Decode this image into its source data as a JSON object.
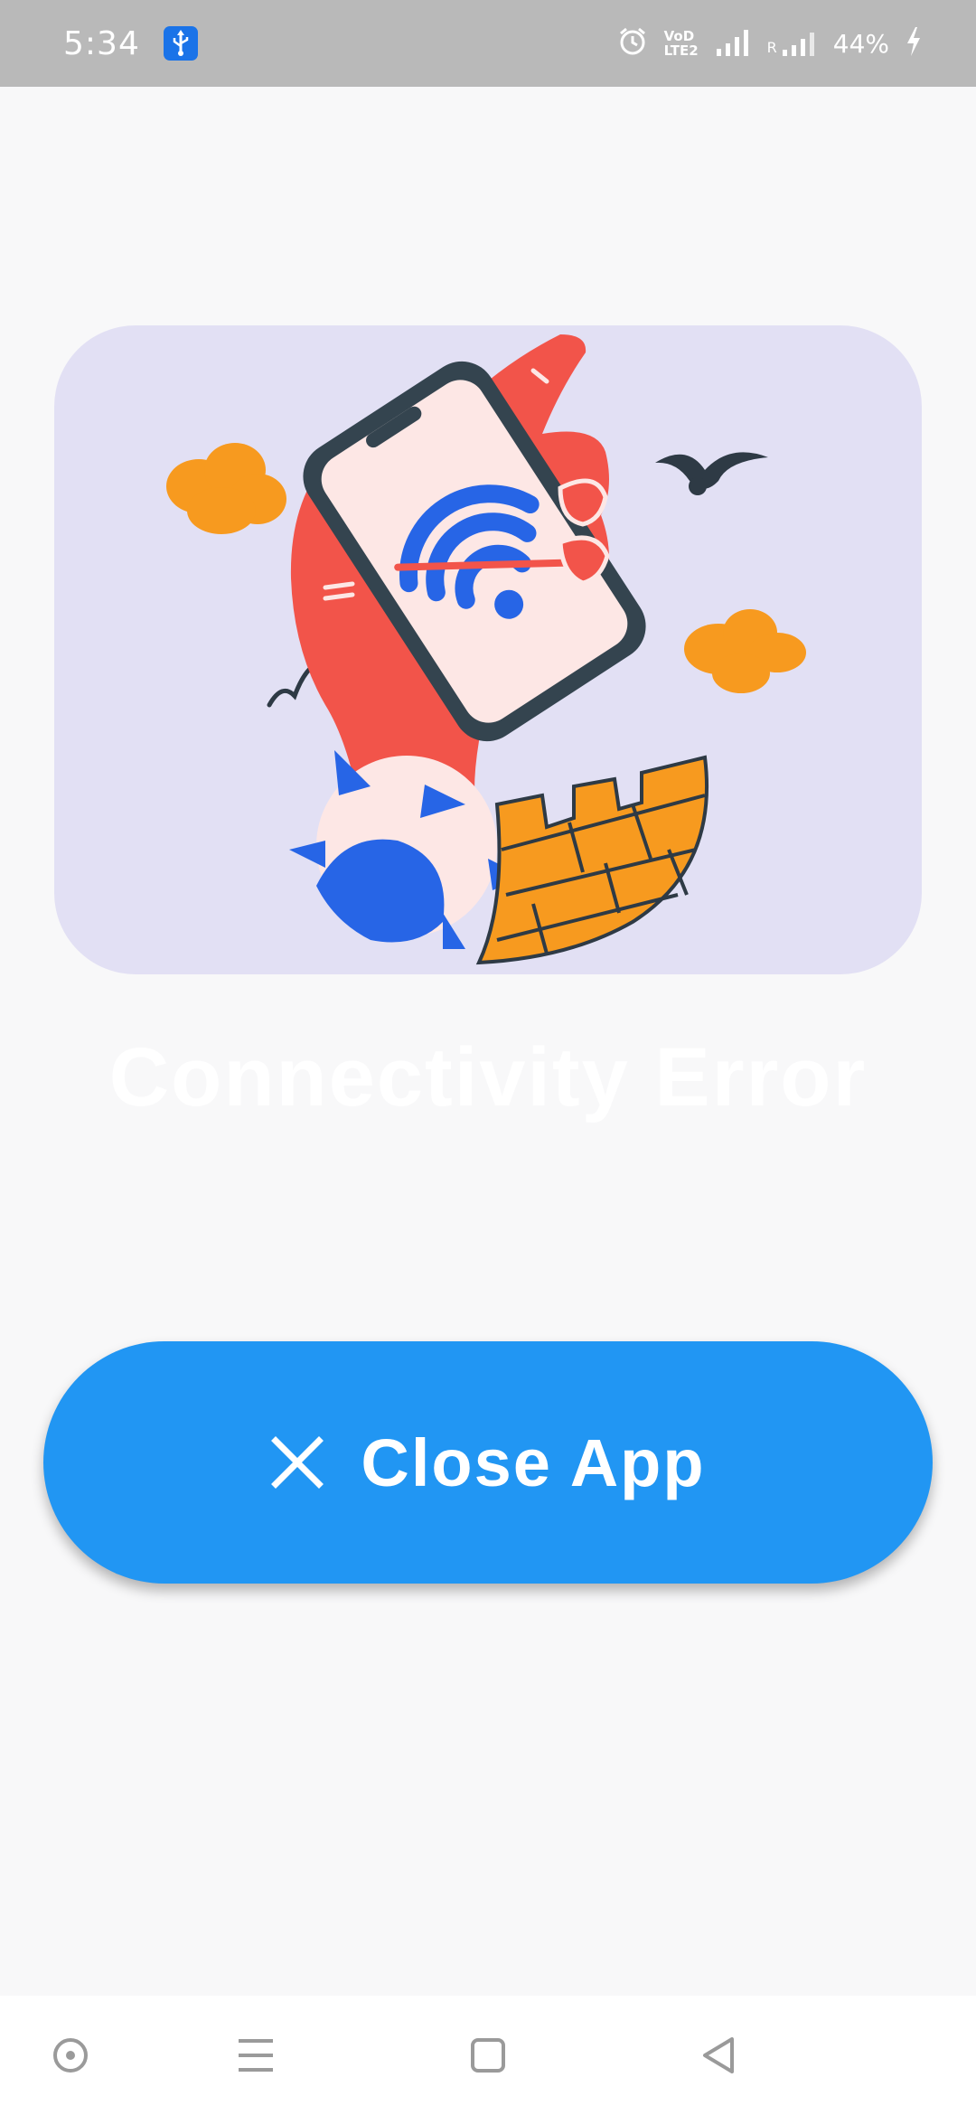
{
  "status_bar": {
    "time": "5:34",
    "battery_percent": "44%",
    "usb_icon": "usb-icon",
    "icons": [
      "alarm-icon",
      "volte-icon",
      "signal-icon",
      "roaming-signal-icon",
      "charging-icon"
    ],
    "volte_top": "VoD",
    "volte_bottom": "LTE2",
    "roaming_label": "R"
  },
  "illustration": {
    "icon": "no-wifi-phone-illustration"
  },
  "main": {
    "title": "Connectivity Error",
    "close_button_label": "Close App",
    "close_button_icon": "close-icon",
    "accent_color": "#2196f3"
  },
  "nav_bar": {
    "buttons": [
      "assistant-button",
      "menu-button",
      "home-button",
      "back-button"
    ]
  }
}
